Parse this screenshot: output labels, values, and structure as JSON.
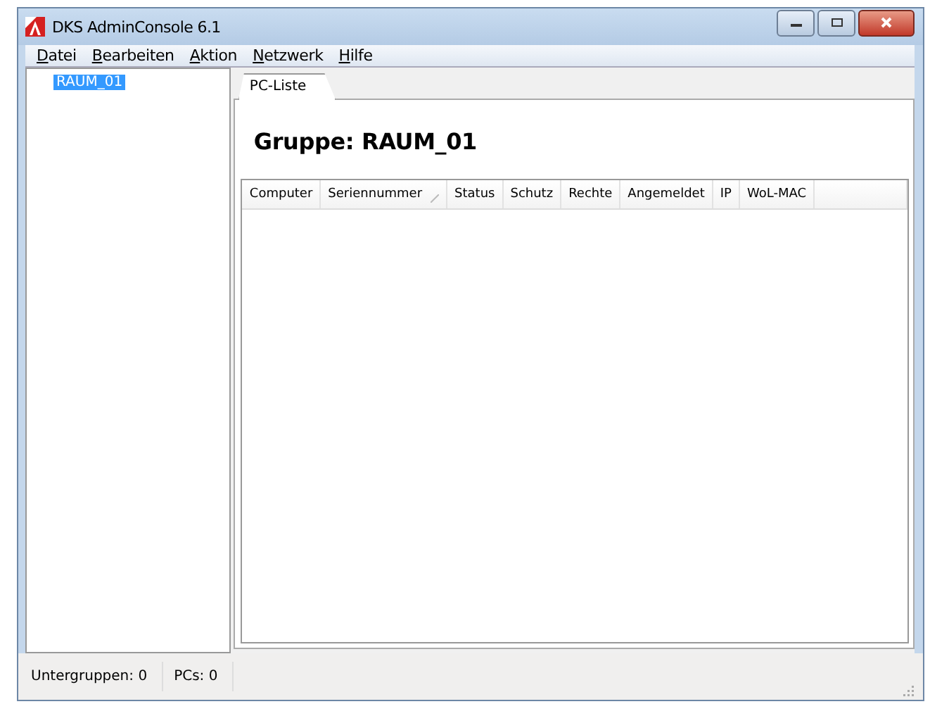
{
  "window": {
    "title": "DKS AdminConsole 6.1"
  },
  "menu": [
    "Datei",
    "Bearbeiten",
    "Aktion",
    "Netzwerk",
    "Hilfe"
  ],
  "tree": {
    "items": [
      {
        "label": "RAUM_01",
        "selected": true
      }
    ]
  },
  "tabs": [
    {
      "label": "PC-Liste",
      "selected": true
    }
  ],
  "heading": "Gruppe: RAUM_01",
  "table": {
    "columns": [
      {
        "label": "Computer",
        "sorted": false
      },
      {
        "label": "Seriennummer",
        "sorted": true
      },
      {
        "label": "Status",
        "sorted": false
      },
      {
        "label": "Schutz",
        "sorted": false
      },
      {
        "label": "Rechte",
        "sorted": false
      },
      {
        "label": "Angemeldet",
        "sorted": false
      },
      {
        "label": "IP",
        "sorted": false
      },
      {
        "label": "WoL-MAC",
        "sorted": false
      }
    ]
  },
  "status_bar": [
    "Untergruppen: 0",
    "PCs: 0"
  ]
}
